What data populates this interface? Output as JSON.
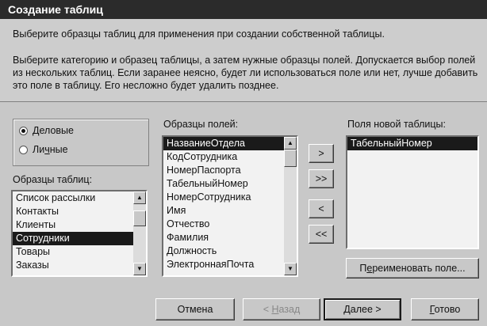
{
  "window": {
    "title": "Создание таблиц"
  },
  "header": {
    "description1": "Выберите образцы таблиц для применения при создании собственной таблицы.",
    "description2": "Выберите категорию и образец таблицы, а затем нужные образцы полей. Допускается выбор полей из нескольких таблиц. Если заранее неясно, будет ли использоваться поле или нет, лучше добавить это поле в таблицу. Его несложно будет удалить позднее."
  },
  "category": {
    "options": [
      {
        "label_u": "Д",
        "label_rest": "еловые",
        "selected": true
      },
      {
        "label_pre": "Ли",
        "label_u": "ч",
        "label_rest": "ные",
        "selected": false
      }
    ]
  },
  "sample_tables": {
    "label": "Образцы таблиц:",
    "items": [
      "Список рассылки",
      "Контакты",
      "Клиенты",
      "Сотрудники",
      "Товары",
      "Заказы"
    ],
    "selected_index": 3
  },
  "sample_fields": {
    "label": "Образцы полей:",
    "items": [
      "НазваниеОтдела",
      "КодСотрудника",
      "НомерПаспорта",
      "ТабельныйНомер",
      "НомерСотрудника",
      "Имя",
      "Отчество",
      "Фамилия",
      "Должность",
      "ЭлектроннаяПочта"
    ],
    "selected_index": 0
  },
  "move_buttons": {
    "add_one": ">",
    "add_all": ">>",
    "remove_one": "<",
    "remove_all": "<<"
  },
  "new_fields": {
    "label": "Поля новой таблицы:",
    "items": [
      "ТабельныйНомер"
    ],
    "selected_index": 0
  },
  "buttons": {
    "rename": {
      "pre": "П",
      "u": "е",
      "rest": "реименовать поле..."
    },
    "cancel": "Отмена",
    "back": {
      "pre": "< ",
      "u": "Н",
      "rest": "азад"
    },
    "next": {
      "u": "Д",
      "rest": "алее >"
    },
    "finish": {
      "u": "Г",
      "rest": "отово"
    }
  }
}
